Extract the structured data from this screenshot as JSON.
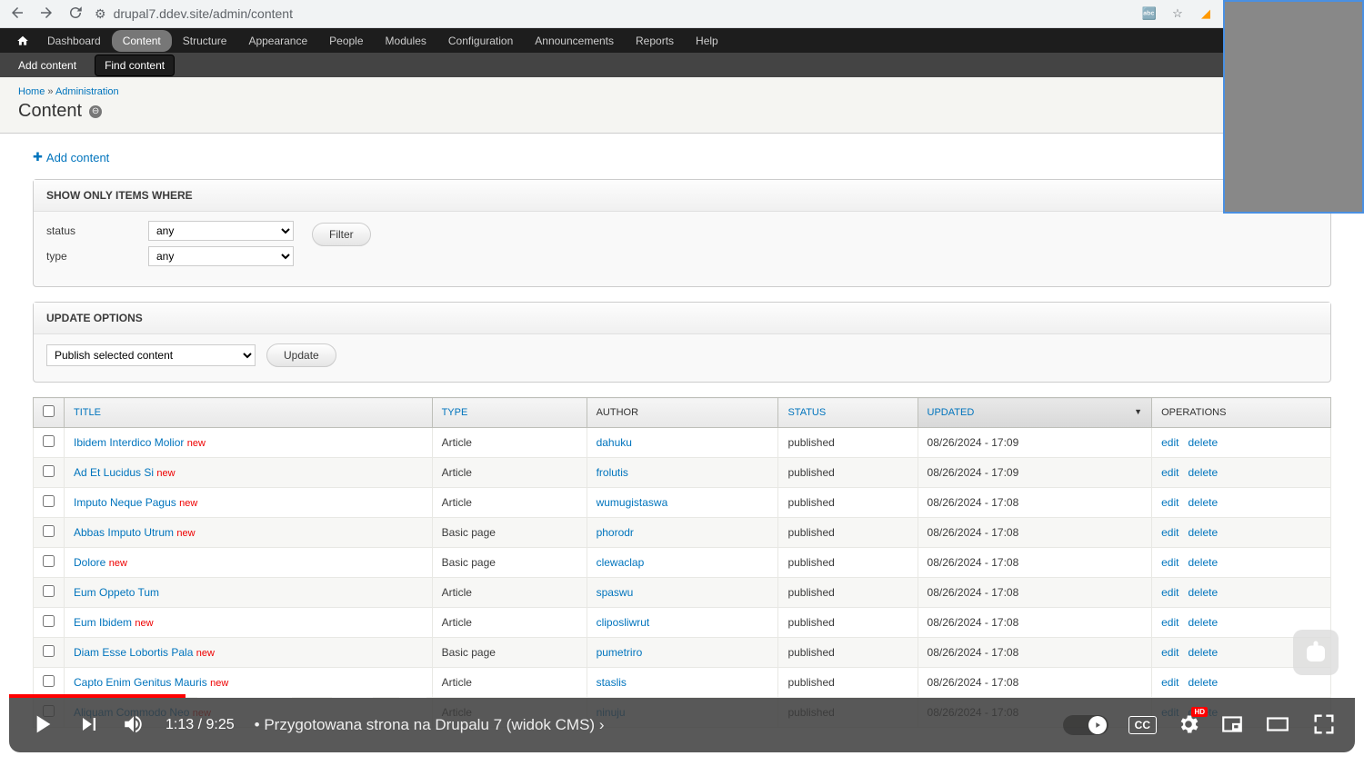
{
  "browser": {
    "url": "drupal7.ddev.site/admin/content"
  },
  "toolbar": {
    "items": [
      "Dashboard",
      "Content",
      "Structure",
      "Appearance",
      "People",
      "Modules",
      "Configuration",
      "Announcements",
      "Reports",
      "Help"
    ],
    "active_index": 1
  },
  "subtoolbar": {
    "add": "Add content",
    "find": "Find content"
  },
  "breadcrumb": {
    "home": "Home",
    "sep": " » ",
    "admin": "Administration"
  },
  "page": {
    "title": "Content"
  },
  "add_link": "Add content",
  "filter": {
    "heading": "SHOW ONLY ITEMS WHERE",
    "status_label": "status",
    "status_value": "any",
    "type_label": "type",
    "type_value": "any",
    "filter_btn": "Filter"
  },
  "update": {
    "heading": "UPDATE OPTIONS",
    "select_value": "Publish selected content",
    "btn": "Update"
  },
  "table": {
    "headers": {
      "title": "TITLE",
      "type": "TYPE",
      "author": "AUTHOR",
      "status": "STATUS",
      "updated": "UPDATED",
      "operations": "OPERATIONS"
    },
    "rows": [
      {
        "title": "Ibidem Interdico Molior",
        "new": "new",
        "type": "Article",
        "author": "dahuku",
        "status": "published",
        "updated": "08/26/2024 - 17:09"
      },
      {
        "title": "Ad Et Lucidus Si",
        "new": "new",
        "type": "Article",
        "author": "frolutis",
        "status": "published",
        "updated": "08/26/2024 - 17:09"
      },
      {
        "title": "Imputo Neque Pagus",
        "new": "new",
        "type": "Article",
        "author": "wumugistaswa",
        "status": "published",
        "updated": "08/26/2024 - 17:08"
      },
      {
        "title": "Abbas Imputo Utrum",
        "new": "new",
        "type": "Basic page",
        "author": "phorodr",
        "status": "published",
        "updated": "08/26/2024 - 17:08"
      },
      {
        "title": "Dolore",
        "new": "new",
        "type": "Basic page",
        "author": "clewaclap",
        "status": "published",
        "updated": "08/26/2024 - 17:08"
      },
      {
        "title": "Eum Oppeto Tum",
        "new": "",
        "type": "Article",
        "author": "spaswu",
        "status": "published",
        "updated": "08/26/2024 - 17:08"
      },
      {
        "title": "Eum Ibidem",
        "new": "new",
        "type": "Article",
        "author": "cliposliwrut",
        "status": "published",
        "updated": "08/26/2024 - 17:08"
      },
      {
        "title": "Diam Esse Lobortis Pala",
        "new": "new",
        "type": "Basic page",
        "author": "pumetriro",
        "status": "published",
        "updated": "08/26/2024 - 17:08"
      },
      {
        "title": "Capto Enim Genitus Mauris",
        "new": "new",
        "type": "Article",
        "author": "staslis",
        "status": "published",
        "updated": "08/26/2024 - 17:08"
      },
      {
        "title": "Aliquam Commodo Neo",
        "new": "new",
        "type": "Article",
        "author": "ninuju",
        "status": "published",
        "updated": "08/26/2024 - 17:08"
      }
    ],
    "ops": {
      "edit": "edit",
      "delete": "delete"
    }
  },
  "player": {
    "current": "1:13",
    "duration": "9:25",
    "separator": " • ",
    "title": "Przygotowana strona na Drupalu 7 (widok CMS)",
    "hd": "HD",
    "cc": "CC"
  }
}
